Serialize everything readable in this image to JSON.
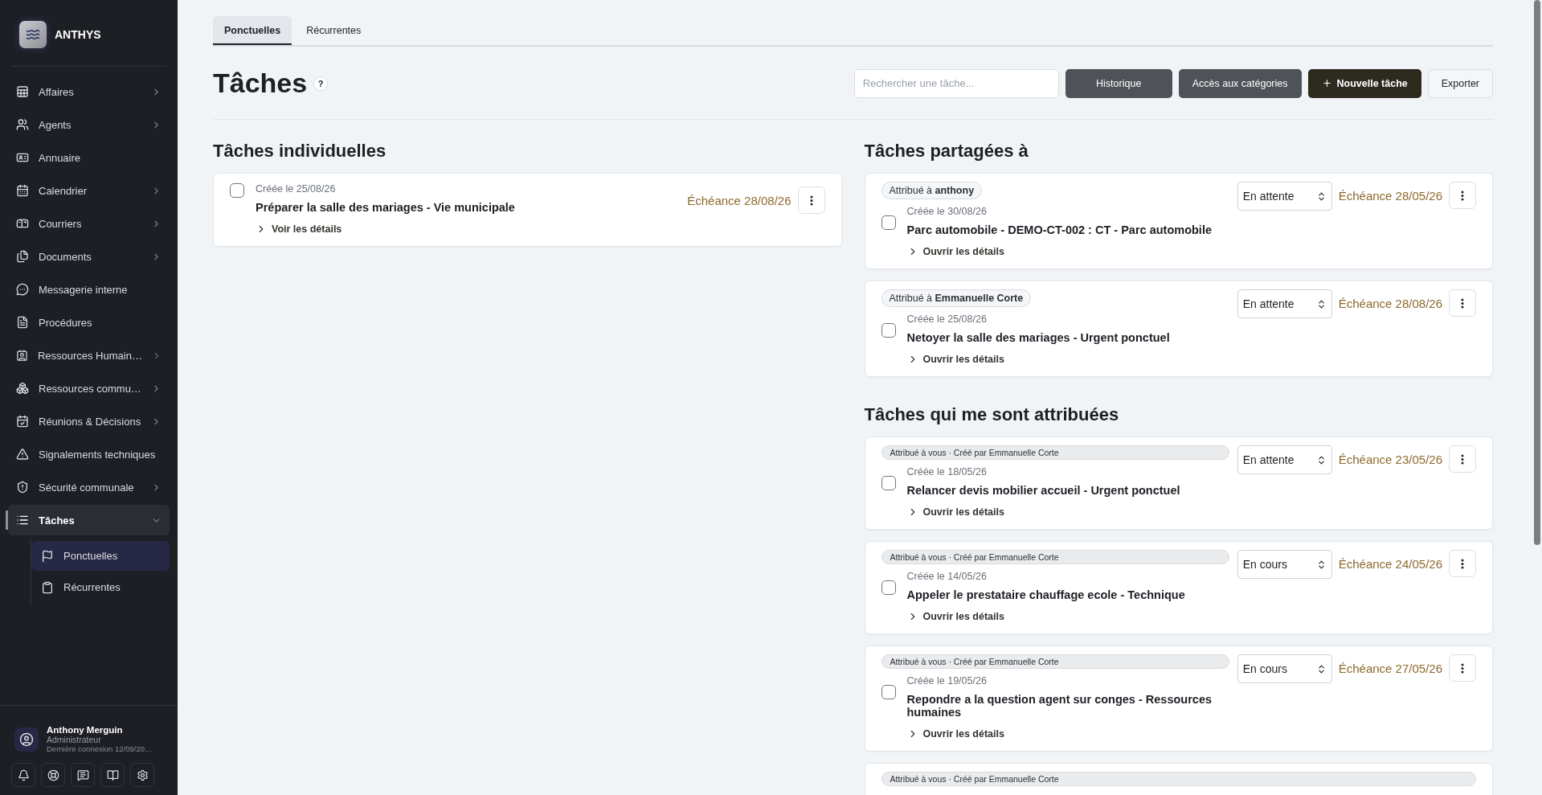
{
  "sidebar": {
    "brand": "ANTHYS",
    "items": [
      {
        "label": "Affaires",
        "expandable": true,
        "selected": false
      },
      {
        "label": "Agents",
        "expandable": true,
        "selected": false
      },
      {
        "label": "Annuaire",
        "expandable": false,
        "selected": false
      },
      {
        "label": "Calendrier",
        "expandable": true,
        "selected": false
      },
      {
        "label": "Courriers",
        "expandable": true,
        "selected": false
      },
      {
        "label": "Documents",
        "expandable": true,
        "selected": false
      },
      {
        "label": "Messagerie interne",
        "expandable": false,
        "selected": false
      },
      {
        "label": "Procédures",
        "expandable": false,
        "selected": false
      },
      {
        "label": "Ressources Humain…",
        "expandable": true,
        "selected": false
      },
      {
        "label": "Ressources commu…",
        "expandable": true,
        "selected": false
      },
      {
        "label": "Réunions & Décisions",
        "expandable": true,
        "selected": false
      },
      {
        "label": "Signalements techniques",
        "expandable": false,
        "selected": false
      },
      {
        "label": "Sécurité communale",
        "expandable": true,
        "selected": false
      },
      {
        "label": "Tâches",
        "expandable": true,
        "selected": true,
        "expanded": true,
        "children": [
          {
            "label": "Ponctuelles",
            "selected": true
          },
          {
            "label": "Récurrentes",
            "selected": false
          }
        ]
      }
    ],
    "user": {
      "name": "Anthony Merguin",
      "role": "Administrateur",
      "last_login": "Dernière connexion 12/09/20…"
    }
  },
  "tabs": [
    {
      "label": "Ponctuelles",
      "selected": true
    },
    {
      "label": "Récurrentes",
      "selected": false
    }
  ],
  "header": {
    "title": "Tâches",
    "help": "?",
    "search": {
      "placeholder": "Rechercher une tâche..."
    },
    "buttons": [
      {
        "label": "Historique",
        "kind": "secondary"
      },
      {
        "label": "Accès aux catégories",
        "kind": "secondary"
      },
      {
        "label": "Nouvelle tâche",
        "kind": "primary"
      },
      {
        "label": "Exporter",
        "kind": "outline"
      }
    ]
  },
  "individual": {
    "title": "Tâches individuelles",
    "tasks": [
      {
        "created": "Créée le 25/08/26",
        "title": "Préparer la salle des mariages - Vie municipale",
        "due": "Échéance 28/08/26",
        "link": "Voir les détails",
        "checked": false
      }
    ]
  },
  "shared": {
    "title": "Tâches partagées à",
    "tasks": [
      {
        "kind": "shared",
        "badge": "Attribué à **anthony**",
        "status": "En attente",
        "created": "Créée le 30/08/26",
        "title": "Parc automobile - DEMO-CT-002 : CT - Parc automobile",
        "due": "Échéance 28/05/26",
        "link": "Ouvrir les détails",
        "checked": false
      },
      {
        "kind": "shared",
        "badge": "Attribué à **Emmanuelle Corte**",
        "status": "En attente",
        "created": "Créée le 25/08/26",
        "title": "Netoyer la salle des mariages - Urgent ponctuel",
        "due": "Échéance 28/08/26",
        "link": "Ouvrir les détails",
        "checked": false
      }
    ]
  },
  "assigned": {
    "title": "Tâches qui me sont attribuées",
    "tasks": [
      {
        "kind": "assigned",
        "badge": "Attribué à vous · Créé par Emmanuelle Corte",
        "status": "En attente",
        "created": "Créée le 18/05/26",
        "title": "Relancer devis mobilier accueil - Urgent ponctuel",
        "due": "Échéance 23/05/26",
        "link": "Ouvrir les détails",
        "checked": false
      },
      {
        "kind": "assigned",
        "badge": "Attribué à vous · Créé par Emmanuelle Corte",
        "status": "En cours",
        "created": "Créée le 14/05/26",
        "title": "Appeler le prestataire chauffage ecole - Technique",
        "due": "Échéance 24/05/26",
        "link": "Ouvrir les détails",
        "checked": false
      },
      {
        "kind": "assigned",
        "badge": "Attribué à vous · Créé par Emmanuelle Corte",
        "status": "En cours",
        "created": "Créée le 19/05/26",
        "title": "Repondre a la question agent sur conges - Ressources humaines",
        "due": "Échéance 27/05/26",
        "link": "Ouvrir les détails",
        "checked": false
      },
      {
        "kind": "assigned",
        "badge": "Attribué à vous · Créé par Emmanuelle Corte"
      }
    ]
  }
}
